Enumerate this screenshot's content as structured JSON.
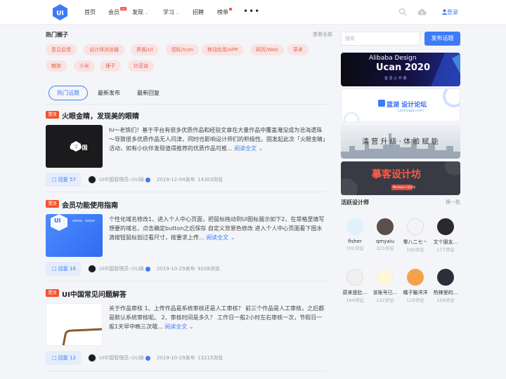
{
  "nav": {
    "items": [
      "首页",
      "会员",
      "发现",
      "学习",
      "招聘",
      "榜单"
    ],
    "hot_tag": "hot",
    "login": "登录"
  },
  "hot_circles": {
    "title": "热门圈子",
    "see_all": "查看全部",
    "tags": [
      "意见反馈",
      "设计师浏览器",
      "界面/UI",
      "图标/Icon",
      "移动应用/APP",
      "网页/Web",
      "草来",
      "魅族",
      "小米",
      "捶子",
      "比亚迪"
    ]
  },
  "tabs": [
    "热门话题",
    "最新发布",
    "最新回复"
  ],
  "badge_label": "置顶",
  "posts": [
    {
      "title": "火眼金睛，发现美的眼睛",
      "excerpt": "hi～老铁们！基于平台有很多优质作品和经验文章在大量作品中覆盖淹没成为沧海遗珠～导致很多优质作品无人问津，同时也影响设计师们的积极性。固发起此次「火眼金睛」活动，如有小伙伴发现值得推荐的优质作品可推...",
      "read_more": "阅读全文",
      "replies": "回复 57",
      "author": "UI中国管理员-小U妹",
      "date": "2019-12-04发布",
      "views": "14303浏览",
      "thumb_text": "UI中国"
    },
    {
      "title": "会员功能使用指南",
      "excerpt": "个性化域名修改1、进入个人中心页面，把鼠标拖动到UI图标展示如下2、在常格里填写想要的域名，点击确定button之后保存 自定义背景色修改 进入个人中心页面看下图水滴按钮鼠标划过看尺寸，按要求上传...",
      "read_more": "阅读全文",
      "replies": "回复 16",
      "author": "UI中国管理员-小U妹",
      "date": "2019-10-29发布",
      "views": "9108浏览",
      "thumb_text": "UI"
    },
    {
      "title": "UI中国常见问题解答",
      "excerpt": "关于作品审核 1、上传作品是系统审核还是人工审核？ 前三个作品是人工审核，之后都是默认系统审核呢。 2、审核时间是多久？ 工作日一般2小时左右审核一次，节假日一般1天早中晚三次哦...",
      "read_more": "阅读全文",
      "replies": "回复 12",
      "author": "UI中国管理员-小U妹",
      "date": "2019-10-29发布",
      "views": "13215浏览"
    }
  ],
  "sidebar": {
    "search_placeholder": "搜索",
    "publish_label": "发布话题",
    "banners": [
      {
        "title": "Alibaba Design",
        "big": "Ucan 2020",
        "sub": "首 思 公 开 课"
      },
      {
        "title": "蓝湖 设计论坛",
        "sub": "Lanhuapp.com"
      },
      {
        "title": "清 营 升 级 · 体 验 赋 能"
      },
      {
        "title": "摹客设计坊",
        "sub": "Mockplus 设计坊"
      }
    ],
    "designers_title": "活跃设计师",
    "refresh_label": "换一批",
    "designers": [
      {
        "name": "fisher",
        "count": "702评论"
      },
      {
        "name": "qmyaiu",
        "count": "323评论"
      },
      {
        "name": "零八二七丶",
        "count": "190评论"
      },
      {
        "name": "文个朋友...",
        "count": "177评论"
      },
      {
        "name": "原来是肚...",
        "count": "164评论"
      },
      {
        "name": "该账号已...",
        "count": "132评论"
      },
      {
        "name": "橘子暖洋洋",
        "count": "129评论"
      },
      {
        "name": "热辣里的...",
        "count": "109评论"
      }
    ]
  },
  "colors": {
    "accent": "#3d7bf7",
    "badge": "#f2532f",
    "tag_bg": "#fbe3e3",
    "tag_text": "#e0674f"
  }
}
